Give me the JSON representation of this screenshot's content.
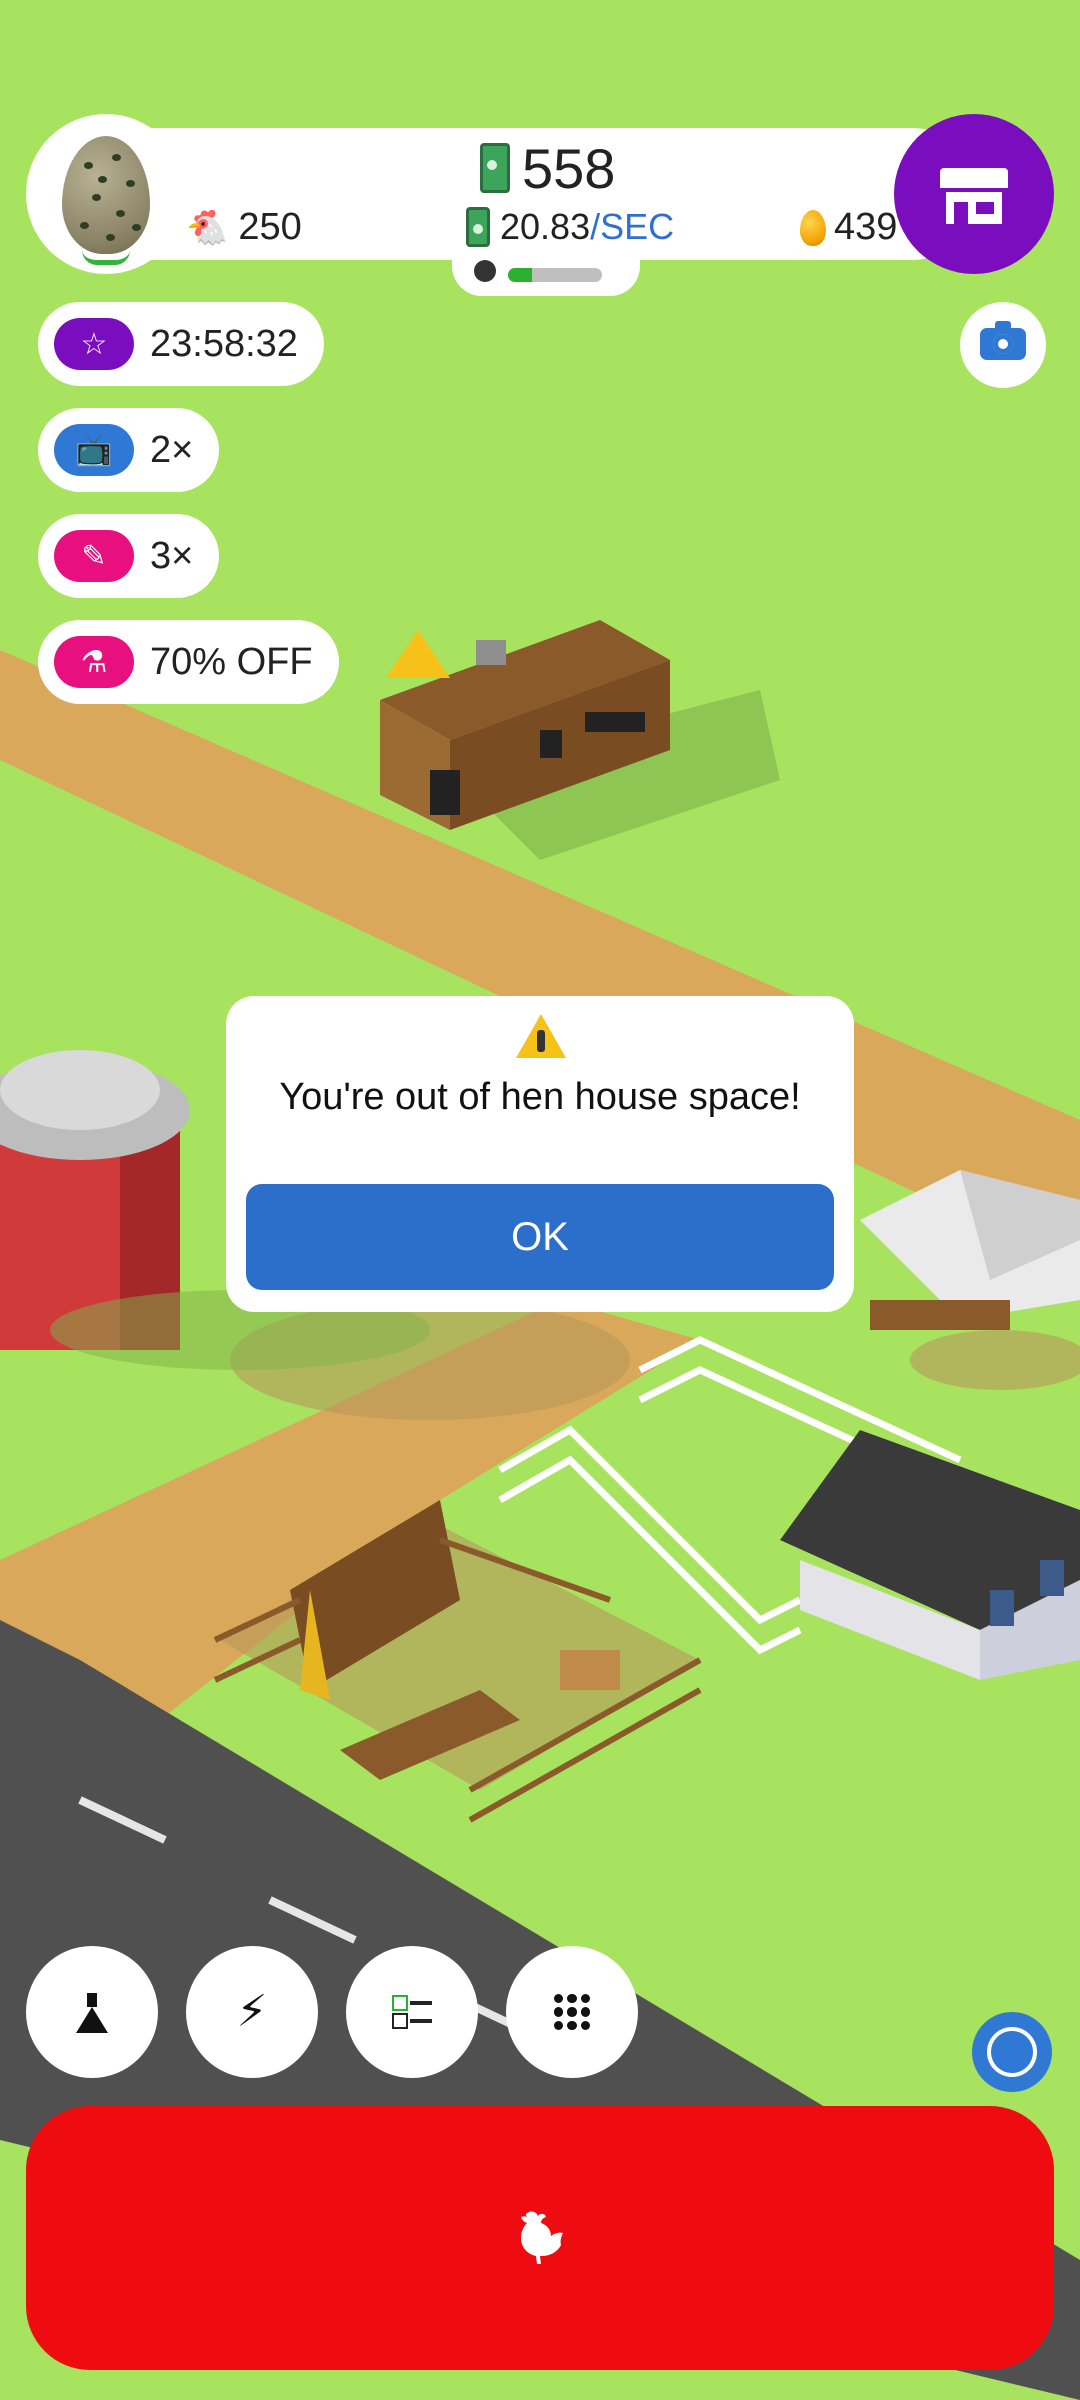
{
  "header": {
    "money": "558",
    "rate_value": "20.83",
    "rate_unit": "/SEC",
    "hens": "250",
    "eggs": "439",
    "hen_progress": 0.25
  },
  "buffs": [
    {
      "icon": "star-icon",
      "label": "23:58:32",
      "color": "#7a0ebf"
    },
    {
      "icon": "tv-icon",
      "label": "2×",
      "color": "#2f78d4"
    },
    {
      "icon": "feather-icon",
      "label": "3×",
      "color": "#e8107f"
    },
    {
      "icon": "flask-icon",
      "label": "70% OFF",
      "color": "#e8107f"
    }
  ],
  "dialog": {
    "message": "You're out of hen house space!",
    "ok_label": "OK"
  },
  "toolbar": [
    {
      "icon": "flask-icon"
    },
    {
      "icon": "lightning-icon"
    },
    {
      "icon": "checklist-icon"
    },
    {
      "icon": "grid-menu-icon"
    }
  ],
  "colors": {
    "grass": "#a8e35f",
    "road": "#505050",
    "dirt": "#d9a85a",
    "shop_button": "#7a0ebf",
    "hatch_button": "#ef0c10",
    "accent_blue": "#2b6fcb"
  }
}
